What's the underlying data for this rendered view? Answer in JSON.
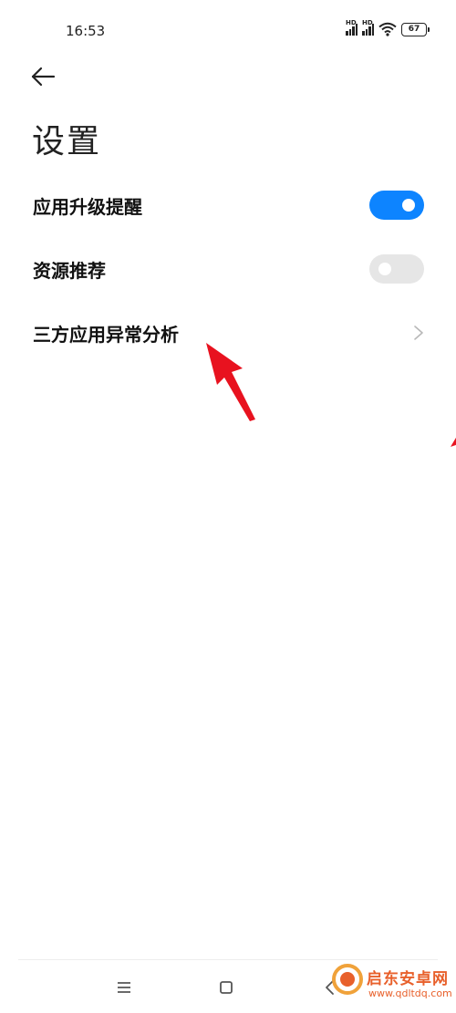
{
  "status_bar": {
    "time": "16:53",
    "hd1": "HD",
    "hd2": "HD",
    "battery": "67"
  },
  "header": {
    "back_icon": "arrow-left-icon",
    "title": "设置"
  },
  "settings": [
    {
      "label": "应用升级提醒",
      "control": "toggle",
      "on": true
    },
    {
      "label": "资源推荐",
      "control": "toggle",
      "on": false
    },
    {
      "label": "三方应用异常分析",
      "control": "chevron"
    }
  ],
  "colors": {
    "toggle_on": "#0d84ff",
    "toggle_off": "#e6e6e6",
    "annotation_arrow": "#e8121f",
    "watermark": "#e8602b"
  },
  "nav_bar": {
    "menu_icon": "menu-icon",
    "home_icon": "square-home-icon",
    "back_icon": "triangle-back-icon"
  },
  "watermark": {
    "text": "启东安卓网",
    "url": "www.qdltdq.com"
  }
}
